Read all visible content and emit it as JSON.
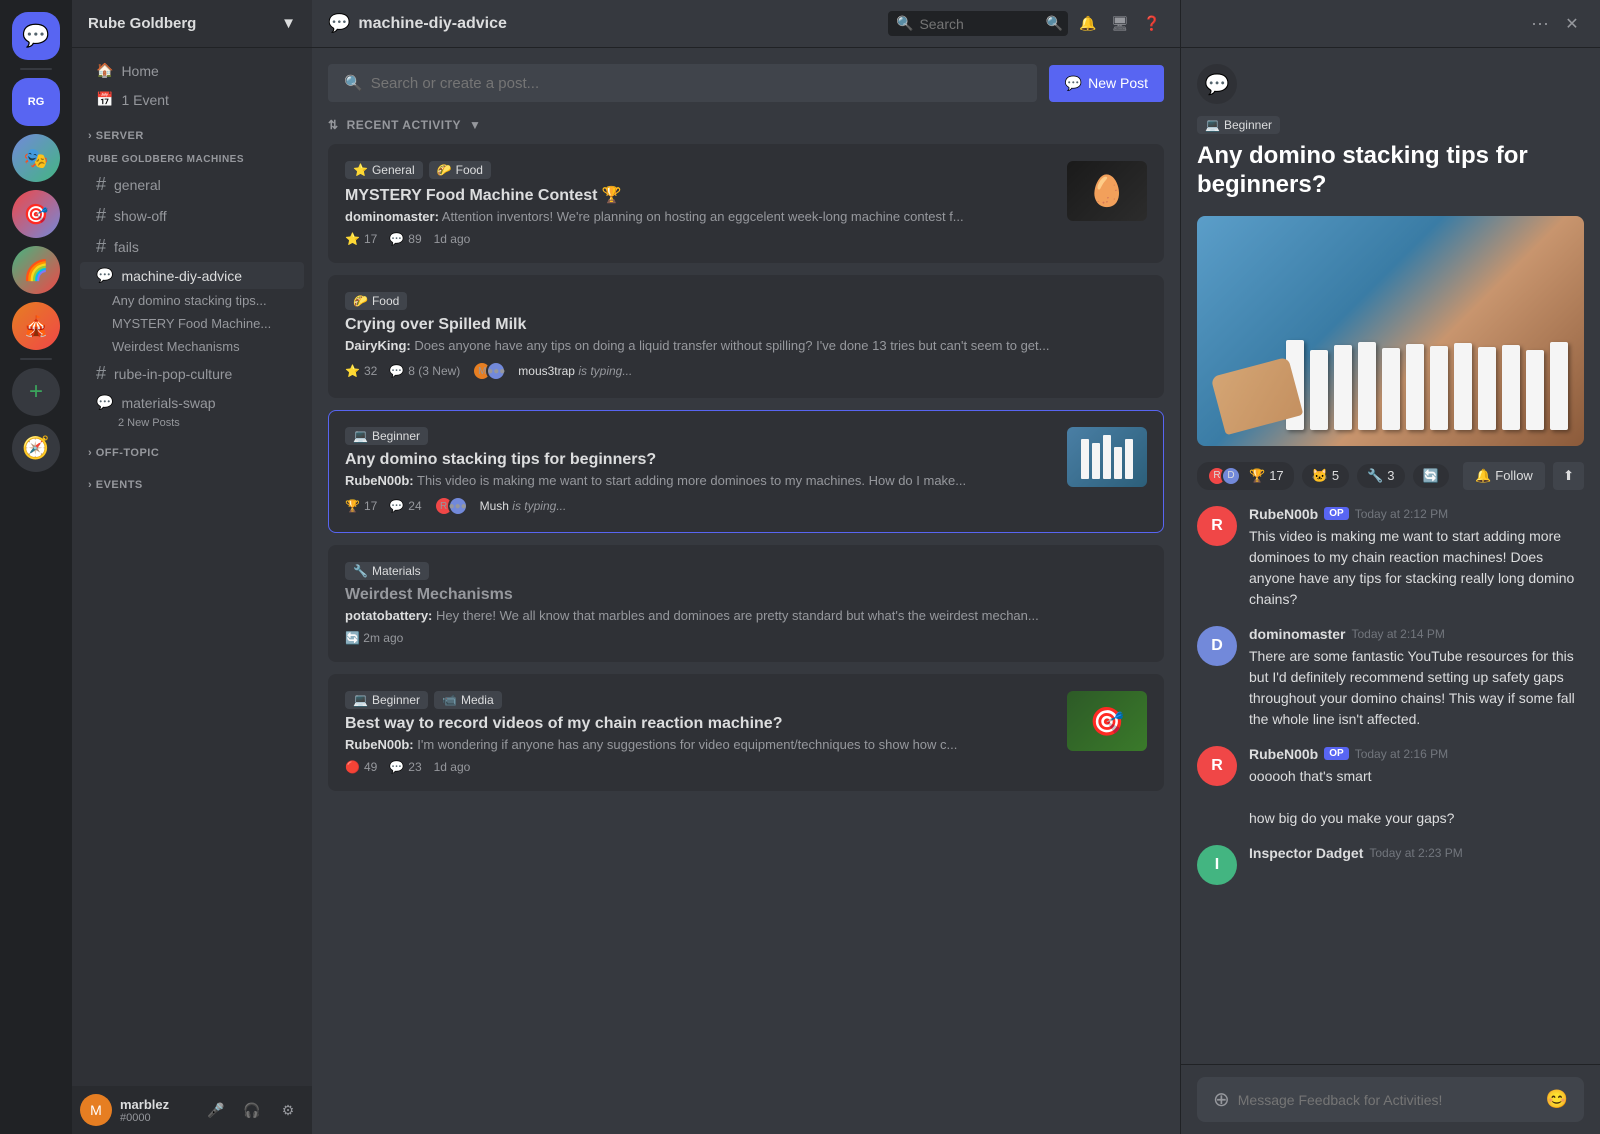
{
  "server": {
    "name": "Rube Goldberg",
    "dropdown_label": "Rube Goldberg",
    "online_indicator": true
  },
  "nav": {
    "home_label": "Home",
    "events_label": "1 Event"
  },
  "sections": {
    "server_label": "SERVER",
    "rube_label": "RUBE GOLDBERG MACHINES",
    "offtopic_label": "OFF-TOPIC",
    "events_label": "EVENTS"
  },
  "channels": [
    {
      "id": "general",
      "label": "general",
      "type": "hash"
    },
    {
      "id": "show-off",
      "label": "show-off",
      "type": "hash"
    },
    {
      "id": "fails",
      "label": "fails",
      "type": "hash"
    },
    {
      "id": "machine-diy-advice",
      "label": "machine-diy-advice",
      "type": "forum",
      "active": true
    },
    {
      "id": "rube-in-pop-culture",
      "label": "rube-in-pop-culture",
      "type": "hash"
    },
    {
      "id": "materials-swap",
      "label": "materials-swap",
      "type": "forum",
      "new_posts": "2 New Posts"
    }
  ],
  "threads": [
    {
      "id": "domino-tips",
      "label": "Any domino stacking tips..."
    },
    {
      "id": "mystery-food",
      "label": "MYSTERY Food Machine..."
    },
    {
      "id": "weirdest-mechanisms",
      "label": "Weirdest Mechanisms"
    }
  ],
  "user": {
    "name": "marblez",
    "tag": "#0000",
    "avatar_letter": "M",
    "avatar_color": "#e67e22"
  },
  "channel_header": {
    "name": "machine-diy-advice",
    "search_placeholder": "Search"
  },
  "forum": {
    "search_placeholder": "Search or create a post...",
    "new_post_label": "New Post",
    "activity_label": "RECENT ACTIVITY"
  },
  "posts": [
    {
      "id": "mystery-food",
      "tags": [
        {
          "emoji": "⭐",
          "label": "General"
        },
        {
          "emoji": "🌮",
          "label": "Food"
        }
      ],
      "title": "MYSTERY Food Machine Contest 🏆",
      "author": "dominomaster",
      "excerpt": "Attention inventors! We're planning on hosting an eggcelent week-long machine contest f...",
      "stars": "17",
      "comments": "89",
      "time": "1d ago",
      "has_thumb": true,
      "thumb_type": "food"
    },
    {
      "id": "spilled-milk",
      "tags": [
        {
          "emoji": "🌮",
          "label": "Food"
        }
      ],
      "title": "Crying over Spilled Milk",
      "author": "DairyKing",
      "excerpt": "Does anyone have any tips on doing a liquid transfer without spilling? I've done 13 tries but can't seem to get...",
      "stars": "32",
      "comments": "8 (3 New)",
      "time": null,
      "typing_user": "mous3trap",
      "typing_text": "is typing...",
      "has_thumb": false
    },
    {
      "id": "domino-tips",
      "tags": [
        {
          "emoji": "💻",
          "label": "Beginner"
        }
      ],
      "title": "Any domino stacking tips for beginners?",
      "author": "RubeN00b",
      "excerpt": "This video is making me want to start adding more dominoes to my machines. How do I make...",
      "stars": "17",
      "comments": "24",
      "time": null,
      "typing_user": "Mush",
      "typing_text": "is typing...",
      "has_thumb": true,
      "thumb_type": "domino",
      "active": true
    },
    {
      "id": "weirdest-mechanisms",
      "tags": [
        {
          "emoji": "🔧",
          "label": "Materials"
        }
      ],
      "title": "Weirdest Mechanisms",
      "author": "potatobattery",
      "excerpt": "Hey there! We all know that marbles and dominoes are pretty standard but what's the weirdest mechan...",
      "stars": null,
      "comments": null,
      "time": "2m ago",
      "has_thumb": false
    },
    {
      "id": "record-videos",
      "tags": [
        {
          "emoji": "💻",
          "label": "Beginner"
        },
        {
          "emoji": "📹",
          "label": "Media"
        }
      ],
      "title": "Best way to record videos of my chain reaction machine?",
      "author": "RubeN00b",
      "excerpt": "I'm wondering if anyone has any suggestions for video equipment/techniques to show how c...",
      "stars": "49",
      "comments": "23",
      "time": "1d ago",
      "has_thumb": true,
      "thumb_type": "video"
    }
  ],
  "detail": {
    "badge": {
      "emoji": "💻",
      "label": "Beginner"
    },
    "title": "Any domino stacking tips for beginners?",
    "reactions": [
      {
        "emoji": "🏆",
        "count": "17"
      },
      {
        "emoji": "🐱",
        "count": "5"
      },
      {
        "emoji": "🔧",
        "count": "3"
      },
      {
        "emoji": "🔄",
        "count": ""
      }
    ],
    "follow_label": "Follow",
    "comments": [
      {
        "id": "c1",
        "author": "RubeN00b",
        "is_op": true,
        "time": "Today at 2:12 PM",
        "text": "This video is making me want to start adding more dominoes to my chain reaction machines! Does anyone have any tips for stacking really long domino chains?",
        "avatar_letter": "R",
        "avatar_color": "#f04747"
      },
      {
        "id": "c2",
        "author": "dominomaster",
        "is_op": false,
        "time": "Today at 2:14 PM",
        "text": "There are some fantastic YouTube resources for this but I'd definitely recommend setting up safety gaps throughout your domino chains! This way if some fall the whole line isn't affected.",
        "avatar_letter": "D",
        "avatar_color": "#7289da"
      },
      {
        "id": "c3",
        "author": "RubeN00b",
        "is_op": true,
        "time": "Today at 2:16 PM",
        "text": "oooooh that's smart\n\nhow big do you make your gaps?",
        "avatar_letter": "R",
        "avatar_color": "#f04747"
      },
      {
        "id": "c4",
        "author": "Inspector Dadget",
        "is_op": false,
        "time": "Today at 2:23 PM",
        "text": "",
        "avatar_letter": "I",
        "avatar_color": "#43b581"
      }
    ],
    "message_placeholder": "Message Feedback for Activities!"
  },
  "icons": {
    "home": "🏠",
    "calendar": "📅",
    "hash": "#",
    "forum": "💬",
    "bell": "🔔",
    "monitor": "🖥",
    "help": "❓",
    "mic": "🎤",
    "headset": "🎧",
    "settings": "⚙",
    "search": "🔍",
    "add": "+",
    "more": "···",
    "close": "✕",
    "sort": "⇅",
    "chevron_down": "▼",
    "chevron_right": "›",
    "pin": "📌",
    "emoji": "😊",
    "plus_circle": "⊕",
    "follow_bell": "🔔",
    "share": "⬆"
  }
}
